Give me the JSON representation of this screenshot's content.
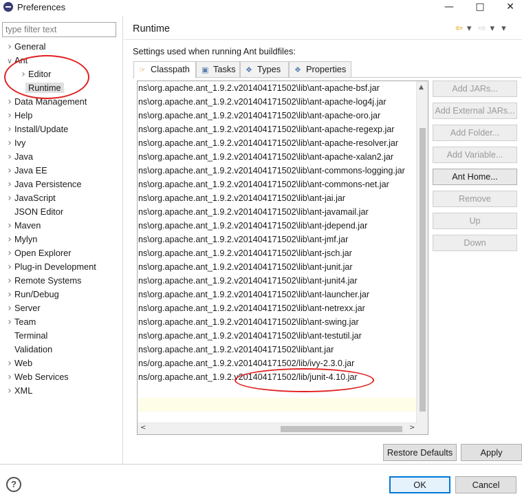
{
  "window": {
    "title": "Preferences",
    "minimize_icon": "minimize-icon",
    "maximize_icon": "maximize-icon",
    "close_icon": "close-icon"
  },
  "sidebar": {
    "filter_placeholder": "type filter text",
    "items": [
      {
        "label": "General",
        "expandable": true
      },
      {
        "label": "Ant",
        "expanded": true
      },
      {
        "label": "Editor",
        "expandable": true,
        "child": true
      },
      {
        "label": "Runtime",
        "child": true,
        "selected": true
      },
      {
        "label": "Data Management",
        "expandable": true
      },
      {
        "label": "Help",
        "expandable": true
      },
      {
        "label": "Install/Update",
        "expandable": true
      },
      {
        "label": "Ivy",
        "expandable": true
      },
      {
        "label": "Java",
        "expandable": true
      },
      {
        "label": "Java EE",
        "expandable": true
      },
      {
        "label": "Java Persistence",
        "expandable": true
      },
      {
        "label": "JavaScript",
        "expandable": true
      },
      {
        "label": "JSON Editor",
        "expandable": false
      },
      {
        "label": "Maven",
        "expandable": true
      },
      {
        "label": "Mylyn",
        "expandable": true
      },
      {
        "label": "Open Explorer",
        "expandable": true
      },
      {
        "label": "Plug-in Development",
        "expandable": true
      },
      {
        "label": "Remote Systems",
        "expandable": true
      },
      {
        "label": "Run/Debug",
        "expandable": true
      },
      {
        "label": "Server",
        "expandable": true
      },
      {
        "label": "Team",
        "expandable": true
      },
      {
        "label": "Terminal",
        "expandable": false
      },
      {
        "label": "Validation",
        "expandable": false
      },
      {
        "label": "Web",
        "expandable": true
      },
      {
        "label": "Web Services",
        "expandable": true
      },
      {
        "label": "XML",
        "expandable": true
      }
    ]
  },
  "page": {
    "title": "Runtime",
    "description": "Settings used when running Ant buildfiles:",
    "tabs": [
      {
        "label": "Classpath",
        "icon": "classpath-icon",
        "active": true
      },
      {
        "label": "Tasks",
        "icon": "tasks-icon"
      },
      {
        "label": "Types",
        "icon": "types-icon"
      },
      {
        "label": "Properties",
        "icon": "properties-icon"
      }
    ],
    "classpath_entries": [
      "ns\\org.apache.ant_1.9.2.v201404171502\\lib\\ant-apache-bsf.jar",
      "ns\\org.apache.ant_1.9.2.v201404171502\\lib\\ant-apache-log4j.jar",
      "ns\\org.apache.ant_1.9.2.v201404171502\\lib\\ant-apache-oro.jar",
      "ns\\org.apache.ant_1.9.2.v201404171502\\lib\\ant-apache-regexp.jar",
      "ns\\org.apache.ant_1.9.2.v201404171502\\lib\\ant-apache-resolver.jar",
      "ns\\org.apache.ant_1.9.2.v201404171502\\lib\\ant-apache-xalan2.jar",
      "ns\\org.apache.ant_1.9.2.v201404171502\\lib\\ant-commons-logging.jar",
      "ns\\org.apache.ant_1.9.2.v201404171502\\lib\\ant-commons-net.jar",
      "ns\\org.apache.ant_1.9.2.v201404171502\\lib\\ant-jai.jar",
      "ns\\org.apache.ant_1.9.2.v201404171502\\lib\\ant-javamail.jar",
      "ns\\org.apache.ant_1.9.2.v201404171502\\lib\\ant-jdepend.jar",
      "ns\\org.apache.ant_1.9.2.v201404171502\\lib\\ant-jmf.jar",
      "ns\\org.apache.ant_1.9.2.v201404171502\\lib\\ant-jsch.jar",
      "ns\\org.apache.ant_1.9.2.v201404171502\\lib\\ant-junit.jar",
      "ns\\org.apache.ant_1.9.2.v201404171502\\lib\\ant-junit4.jar",
      "ns\\org.apache.ant_1.9.2.v201404171502\\lib\\ant-launcher.jar",
      "ns\\org.apache.ant_1.9.2.v201404171502\\lib\\ant-netrexx.jar",
      "ns\\org.apache.ant_1.9.2.v201404171502\\lib\\ant-swing.jar",
      "ns\\org.apache.ant_1.9.2.v201404171502\\lib\\ant-testutil.jar",
      "ns\\org.apache.ant_1.9.2.v201404171502\\lib\\ant.jar",
      "ns/org.apache.ant_1.9.2.v201404171502/lib/ivy-2.3.0.jar",
      "ns/org.apache.ant_1.9.2.v201404171502/lib/junit-4.10.jar"
    ],
    "side_buttons": [
      {
        "label": "Add JARs...",
        "enabled": false
      },
      {
        "label": "Add External JARs...",
        "enabled": false
      },
      {
        "label": "Add Folder...",
        "enabled": false
      },
      {
        "label": "Add Variable...",
        "enabled": false
      },
      {
        "label": "Ant Home...",
        "enabled": true
      },
      {
        "label": "Remove",
        "enabled": false
      },
      {
        "label": "Up",
        "enabled": false
      },
      {
        "label": "Down",
        "enabled": false
      }
    ],
    "restore_defaults": "Restore Defaults",
    "apply": "Apply"
  },
  "footer": {
    "ok": "OK",
    "cancel": "Cancel",
    "help_icon": "help-icon"
  },
  "colors": {
    "annotation": "#e02020",
    "primary_border": "#0078d7",
    "selected_bg": "#e0e0e0"
  }
}
